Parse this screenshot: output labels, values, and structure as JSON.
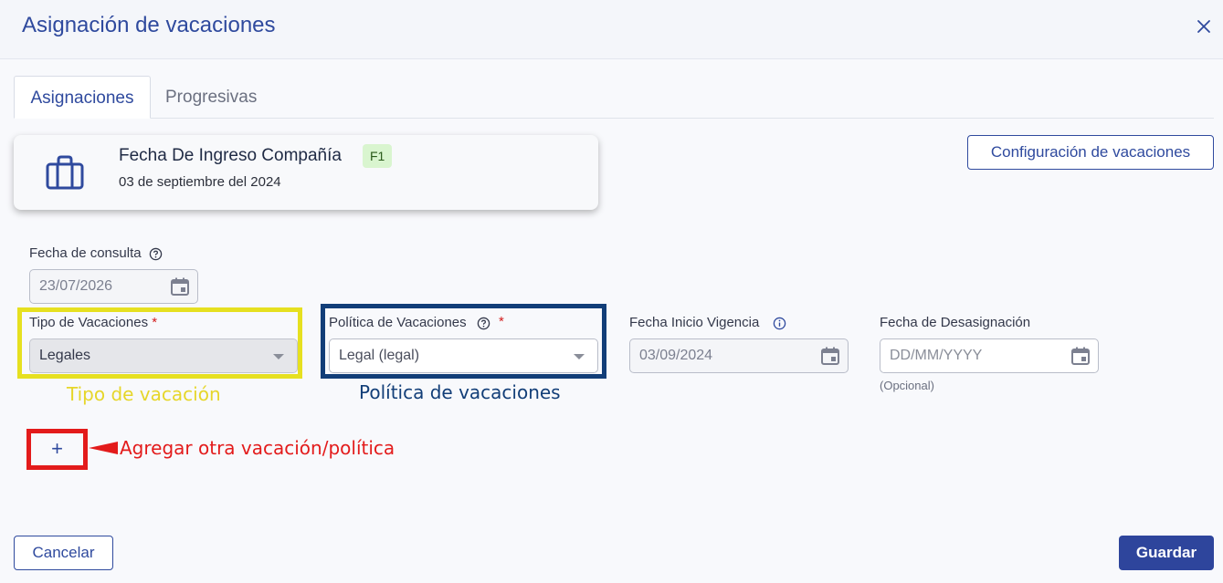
{
  "dialog": {
    "title": "Asignación de vacaciones"
  },
  "tabs": [
    {
      "label": "Asignaciones"
    },
    {
      "label": "Progresivas"
    }
  ],
  "card": {
    "title": "Fecha De Ingreso Compañía",
    "badge": "F1",
    "date": "03 de septiembre del 2024",
    "icon": "briefcase-icon"
  },
  "config_button": "Configuración de vacaciones",
  "fecha_consulta": {
    "label": "Fecha de consulta",
    "value": "23/07/2026"
  },
  "tipo_vacaciones": {
    "label": "Tipo de Vacaciones",
    "required_mark": "*",
    "value": "Legales"
  },
  "politica_vacaciones": {
    "label": "Política de Vacaciones",
    "required_mark": "*",
    "value": "Legal (legal)"
  },
  "fecha_inicio_vigencia": {
    "label": "Fecha Inicio Vigencia",
    "value": "03/09/2024"
  },
  "fecha_desasignacion": {
    "label": "Fecha de Desasignación",
    "placeholder": "DD/MM/YYYY",
    "hint": "(Opcional)"
  },
  "annotations": {
    "tipo": "Tipo de vacación",
    "politica": "Política de vacaciones",
    "agregar": "Agregar otra vacación/política"
  },
  "add_button": "+",
  "footer": {
    "cancel": "Cancelar",
    "save": "Guardar"
  },
  "colors": {
    "primary": "#2f4a9e",
    "badge_bg": "#d9f5cf",
    "highlight_yellow": "#e6e020",
    "highlight_blue": "#123e78",
    "highlight_red": "#e31b1b"
  }
}
